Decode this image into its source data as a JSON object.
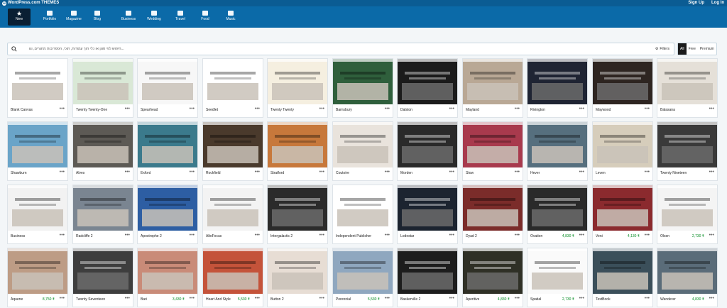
{
  "masterbar": {
    "brand": "WordPress.com THEMES",
    "sign_up": "Sign Up",
    "log_in": "Log In"
  },
  "categories": [
    {
      "label": "New",
      "icon": "star-icon",
      "active": true
    },
    {
      "label": "Portfolio",
      "icon": "portfolio-icon"
    },
    {
      "label": "Magazine",
      "icon": "magazine-icon"
    },
    {
      "label": "Blog",
      "icon": "blog-icon"
    },
    {
      "label": "Business",
      "icon": "cart-icon"
    },
    {
      "label": "Wedding",
      "icon": "heart-icon"
    },
    {
      "label": "Travel",
      "icon": "globe-icon"
    },
    {
      "label": "Food",
      "icon": "food-icon"
    },
    {
      "label": "Music",
      "icon": "music-icon"
    }
  ],
  "search": {
    "placeholder": "חיפוש לפי סוגן או כלי תוך עמודות, תוכי, הספריבות מחגרים, וגו...",
    "filters_label": "Filters"
  },
  "pricing_segments": [
    "All",
    "Free",
    "Premium"
  ],
  "pricing_active": "All",
  "themes": [
    {
      "name": "Blank Canvas",
      "price": "",
      "color": "#ffffff"
    },
    {
      "name": "Twenty Twenty-One",
      "price": "",
      "color": "#d9e8d6"
    },
    {
      "name": "Spearhead",
      "price": "",
      "color": "#f7f7f7"
    },
    {
      "name": "Seedlet",
      "price": "",
      "color": "#ffffff"
    },
    {
      "name": "Twenty Twenty",
      "price": "",
      "color": "#f5efe0"
    },
    {
      "name": "Barnsbury",
      "price": "",
      "color": "#2f5f3c"
    },
    {
      "name": "Dalston",
      "price": "",
      "color": "#1b1b1b"
    },
    {
      "name": "Mayland",
      "price": "",
      "color": "#b9a895"
    },
    {
      "name": "Rivington",
      "price": "",
      "color": "#1f2433"
    },
    {
      "name": "Maywood",
      "price": "",
      "color": "#2e2521"
    },
    {
      "name": "Balasana",
      "price": "",
      "color": "#e5e0d8"
    },
    {
      "name": "Shawburn",
      "price": "",
      "color": "#6aa4c8"
    },
    {
      "name": "Alves",
      "price": "",
      "color": "#5d5a55"
    },
    {
      "name": "Exford",
      "price": "",
      "color": "#3b7a8c"
    },
    {
      "name": "Rockfield",
      "price": "",
      "color": "#4a3a2c"
    },
    {
      "name": "Stratford",
      "price": "",
      "color": "#c7783b"
    },
    {
      "name": "Coutoire",
      "price": "",
      "color": "#e9e3dc"
    },
    {
      "name": "Morden",
      "price": "",
      "color": "#2a2a2a"
    },
    {
      "name": "Stow",
      "price": "",
      "color": "#a83a4d"
    },
    {
      "name": "Hever",
      "price": "",
      "color": "#566f7e"
    },
    {
      "name": "Leven",
      "price": "",
      "color": "#d6cdbb"
    },
    {
      "name": "Twenty Nineteen",
      "price": "",
      "color": "#3a3a3a"
    },
    {
      "name": "Business",
      "price": "",
      "color": "#f2f2f2"
    },
    {
      "name": "Radcliffe 2",
      "price": "",
      "color": "#7a8591"
    },
    {
      "name": "Apostrophe 2",
      "price": "",
      "color": "#2d5ea3"
    },
    {
      "name": "AltoFocus",
      "price": "",
      "color": "#f3f3f3"
    },
    {
      "name": "Intergalactic 2",
      "price": "",
      "color": "#2b2b2b"
    },
    {
      "name": "Independent Publisher",
      "price": "",
      "color": "#ffffff"
    },
    {
      "name": "Lodestar",
      "price": "",
      "color": "#1c2430"
    },
    {
      "name": "Dyad 2",
      "price": "",
      "color": "#7b2c2a"
    },
    {
      "name": "Ovation",
      "price": "4,830 ₹",
      "color": "#2a2a2a"
    },
    {
      "name": "Veni",
      "price": "4,130 ₹",
      "color": "#8b2a2e"
    },
    {
      "name": "Olsen",
      "price": "2,730 ₹",
      "color": "#f4f4f4"
    },
    {
      "name": "Aquene",
      "price": "8,750 ₹",
      "color": "#bd9c85"
    },
    {
      "name": "Twenty Seventeen",
      "price": "",
      "color": "#3e3e3e"
    },
    {
      "name": "Bari",
      "price": "3,430 ₹",
      "color": "#c98b78"
    },
    {
      "name": "Heart And Style",
      "price": "5,530 ₹",
      "color": "#c4533a"
    },
    {
      "name": "Button 2",
      "price": "",
      "color": "#e7ddd4"
    },
    {
      "name": "Perennial",
      "price": "5,530 ₹",
      "color": "#8fa7bf"
    },
    {
      "name": "Baskerville 2",
      "price": "",
      "color": "#1d1d1d"
    },
    {
      "name": "Aperitive",
      "price": "4,830 ₹",
      "color": "#2f3026"
    },
    {
      "name": "Spatial",
      "price": "2,730 ₹",
      "color": "#fafafa"
    },
    {
      "name": "TextBook",
      "price": "",
      "color": "#3b4f5a"
    },
    {
      "name": "Wanderer",
      "price": "4,830 ₹",
      "color": "#5a6c79"
    }
  ]
}
